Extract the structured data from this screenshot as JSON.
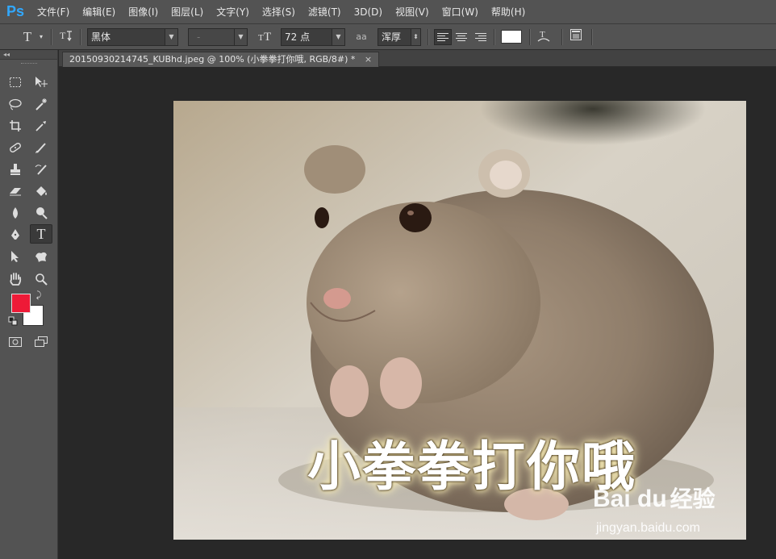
{
  "app": {
    "logo": "Ps"
  },
  "menu": [
    "文件(F)",
    "编辑(E)",
    "图像(I)",
    "图层(L)",
    "文字(Y)",
    "选择(S)",
    "滤镜(T)",
    "3D(D)",
    "视图(V)",
    "窗口(W)",
    "帮助(H)"
  ],
  "options": {
    "font_family": "黑体",
    "font_style": "-",
    "font_size": "72 点",
    "antialias_icon": "aa",
    "antialias": "浑厚",
    "text_color": "#ffffff"
  },
  "panel": {
    "collapse": "◂◂"
  },
  "document": {
    "tab_title": "20150930214745_KUBhd.jpeg @ 100% (小拳拳打你哦, RGB/8#) *",
    "close": "×"
  },
  "colors": {
    "foreground": "#ee1a37",
    "background": "#ffffff"
  },
  "image": {
    "caption": "小拳拳打你哦",
    "watermark": "Bai du",
    "watermark_sub": "经验",
    "watermark_url": "jingyan.baidu.com"
  },
  "icons": [
    "marquee-icon",
    "move-icon",
    "lasso-icon",
    "magic-wand-icon",
    "crop-icon",
    "eyedropper-icon",
    "healing-brush-icon",
    "brush-icon",
    "clone-stamp-icon",
    "history-brush-icon",
    "eraser-icon",
    "paint-bucket-icon",
    "blur-icon",
    "dodge-icon",
    "pen-icon",
    "type-icon",
    "path-selection-icon",
    "custom-shape-icon",
    "hand-icon",
    "zoom-icon",
    "quick-mask-icon",
    "screen-mode-icon"
  ]
}
